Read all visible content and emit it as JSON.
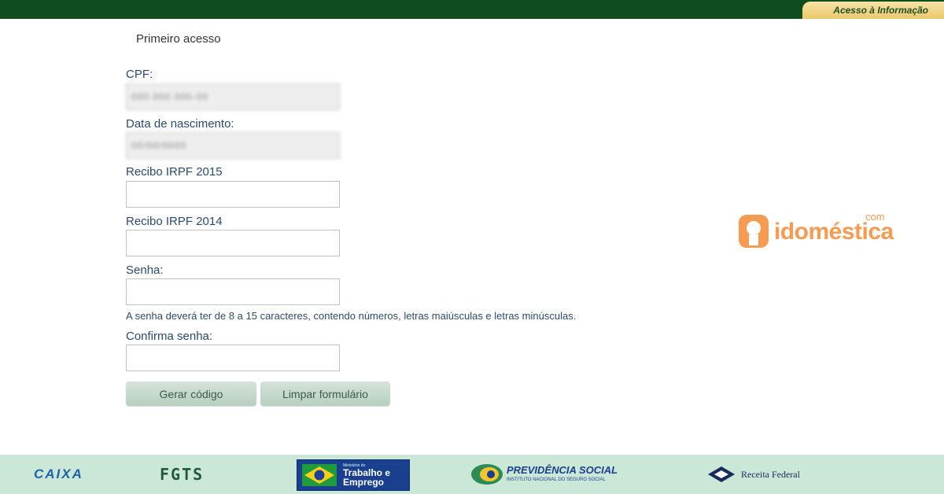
{
  "header": {
    "access_link": "Acesso à Informação",
    "bar_color": "#0f4d1e"
  },
  "form": {
    "title": "Primeiro acesso",
    "cpf": {
      "label": "CPF:",
      "value": "000.000.000-00"
    },
    "birth": {
      "label": "Data de nascimento:",
      "value": "00/00/0000"
    },
    "irpf2015": {
      "label": "Recibo IRPF 2015",
      "value": ""
    },
    "irpf2014": {
      "label": "Recibo IRPF 2014",
      "value": ""
    },
    "password": {
      "label": "Senha:",
      "value": ""
    },
    "password_hint": "A senha deverá ter de 8 a 15 caracteres, contendo números, letras maiúsculas e letras minúsculas.",
    "confirm": {
      "label": "Confirma senha:",
      "value": ""
    },
    "buttons": {
      "generate": "Gerar código",
      "clear": "Limpar formulário"
    }
  },
  "watermark": {
    "brand": "idoméstica",
    "suffix": "com",
    "color": "#f59b52"
  },
  "footer": {
    "caixa": "CAIXA",
    "fgts": "FGTS",
    "mte_small": "Ministério do",
    "mte_big_1": "Trabalho e",
    "mte_big_2": "Emprego",
    "previdencia_title": "PREVIDÊNCIA SOCIAL",
    "previdencia_sub": "INSTITUTO NACIONAL DO SEGURO SOCIAL",
    "receita": "Receita Federal"
  }
}
